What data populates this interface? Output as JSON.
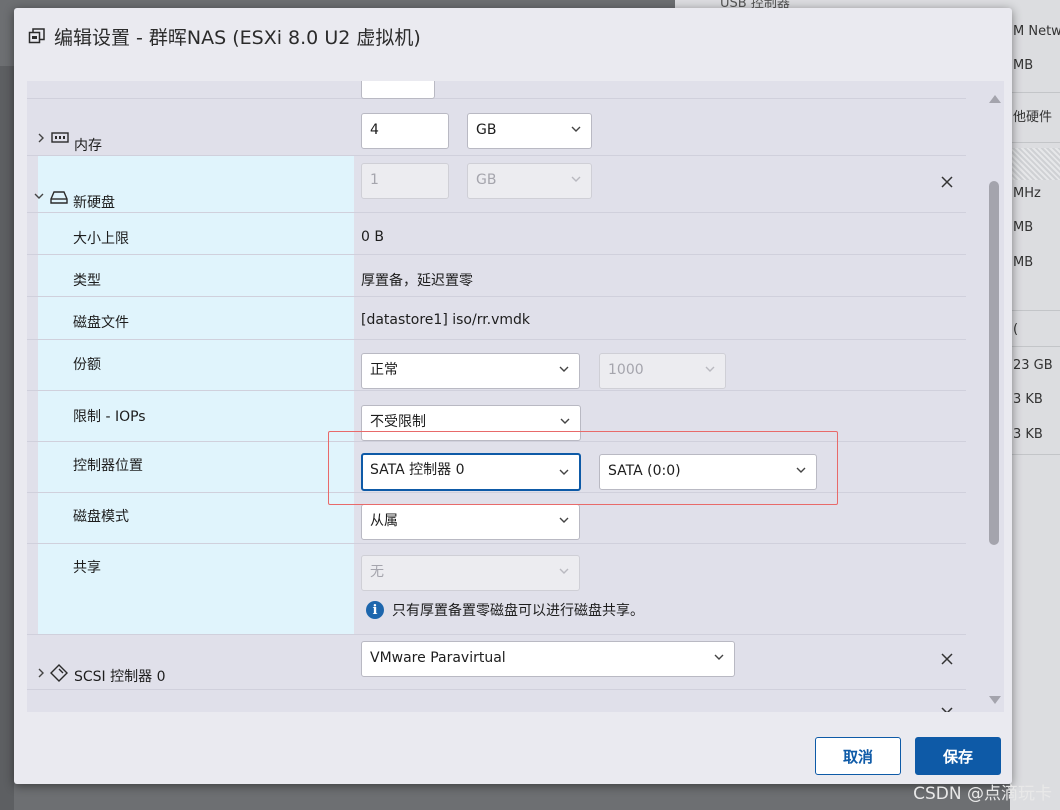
{
  "dialog": {
    "title": "编辑设置 - 群晖NAS (ESXi 8.0 U2 虚拟机)",
    "cancel_label": "取消",
    "save_label": "保存"
  },
  "background_panel": {
    "items": [
      "USB 控制器",
      "M Netw",
      "MB",
      "他硬件",
      "MHz",
      "MB",
      "MB",
      "(",
      "23 GB",
      "3 KB",
      "3 KB"
    ]
  },
  "rows": {
    "memory": {
      "label": "内存",
      "value": "4",
      "unit": "GB"
    },
    "new_disk": {
      "label": "新硬盘",
      "value": "1",
      "unit": "GB"
    },
    "max_size": {
      "label": "大小上限",
      "value": "0 B"
    },
    "type": {
      "label": "类型",
      "value": "厚置备，延迟置零"
    },
    "disk_file": {
      "label": "磁盘文件",
      "value": "[datastore1] iso/rr.vmdk"
    },
    "shares": {
      "label": "份额",
      "value": "正常",
      "amount": "1000"
    },
    "limit_iops": {
      "label": "限制 - IOPs",
      "value": "不受限制"
    },
    "controller_location": {
      "label": "控制器位置",
      "controller": "SATA 控制器 0",
      "slot": "SATA (0:0)"
    },
    "disk_mode": {
      "label": "磁盘模式",
      "value": "从属"
    },
    "sharing": {
      "label": "共享",
      "value": "无",
      "info": "只有厚置备置零磁盘可以进行磁盘共享。"
    },
    "scsi_controller": {
      "label": "SCSI 控制器 0",
      "value": "VMware Paravirtual"
    }
  },
  "watermark": "CSDN @点滴玩卡",
  "colors": {
    "accent": "#0e5aa7",
    "selected_row_bg": "#e0f4fc",
    "highlight_border": "#e86a6a"
  }
}
